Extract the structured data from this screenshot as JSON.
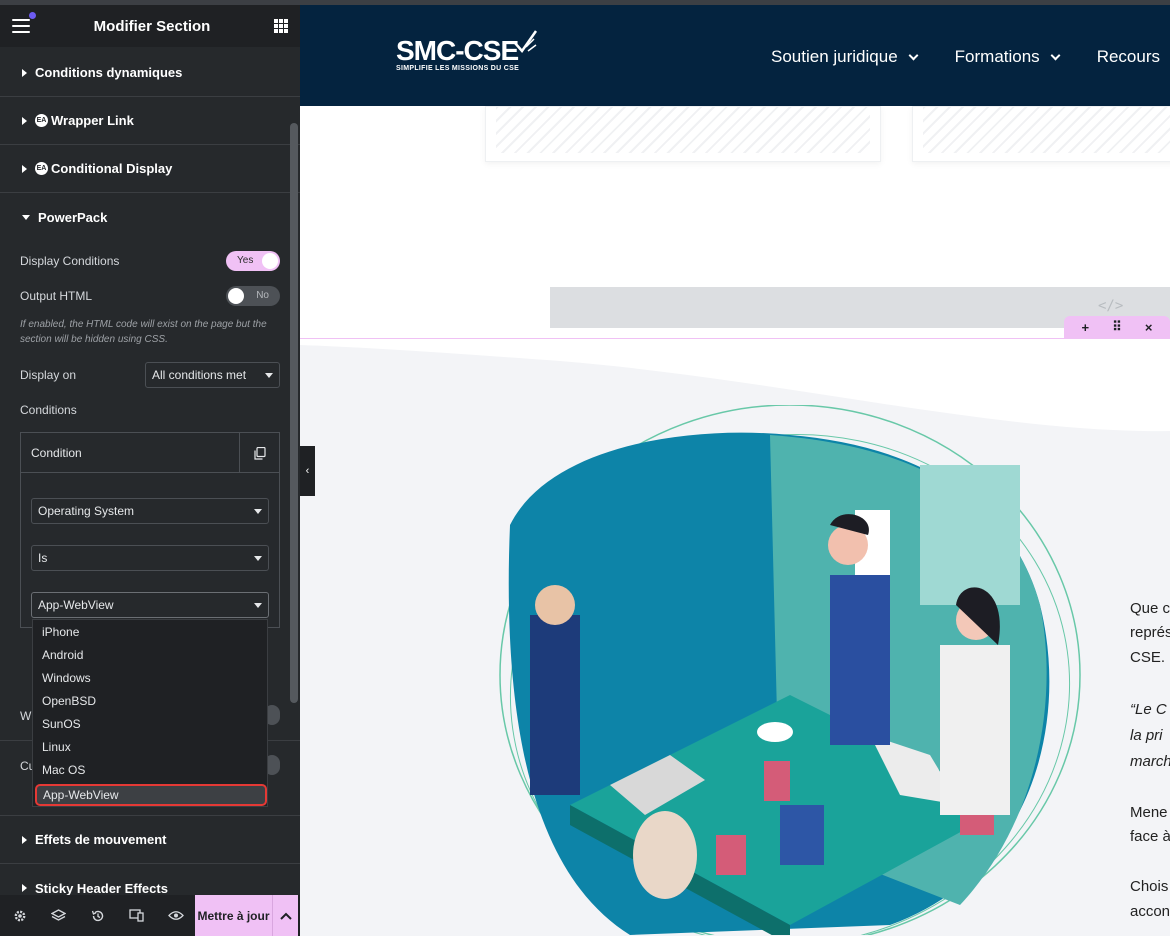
{
  "panel": {
    "title": "Modifier Section",
    "sections": {
      "conditions_dynamiques": "Conditions dynamiques",
      "wrapper_link": "Wrapper Link",
      "conditional_display": "Conditional Display",
      "powerpack": "PowerPack",
      "effets_mouvement": "Effets de mouvement",
      "sticky_header": "Sticky Header Effects"
    },
    "ea_badge": "EA",
    "display_conditions": {
      "label": "Display Conditions",
      "value": "Yes"
    },
    "output_html": {
      "label": "Output HTML",
      "value": "No"
    },
    "help_text": "If enabled, the HTML code will exist on the page but the section will be hidden using CSS.",
    "display_on": {
      "label": "Display on",
      "value": "All conditions met"
    },
    "conditions_label": "Conditions",
    "condition": {
      "title": "Condition",
      "type": "Operating System",
      "operator": "Is",
      "value": "App-WebView"
    },
    "dropdown_options": [
      "iPhone",
      "Android",
      "Windows",
      "OpenBSD",
      "SunOS",
      "Linux",
      "Mac OS",
      "App-WebView"
    ],
    "hidden_ctrl_1": "W",
    "hidden_ctrl_2": "Cu",
    "update_button": "Mettre à jour",
    "accent": "#f0c1f5",
    "highlight": "#e53935"
  },
  "site": {
    "logo_main": "SMC-CSE",
    "logo_sub": "SIMPLIFIE LES MISSIONS DU CSE",
    "nav": [
      "Soutien juridique",
      "Formations",
      "Recours"
    ],
    "header_color": "#04233f",
    "code_glyph": "</>",
    "handle": {
      "add": "+",
      "move": "⠿",
      "close": "×"
    },
    "side_text": [
      "Que c",
      "représ",
      "CSE.",
      "“Le C",
      "la pri",
      "march",
      "Mene",
      "face à",
      "Chois",
      "accon"
    ]
  },
  "collapse_glyph": "‹"
}
